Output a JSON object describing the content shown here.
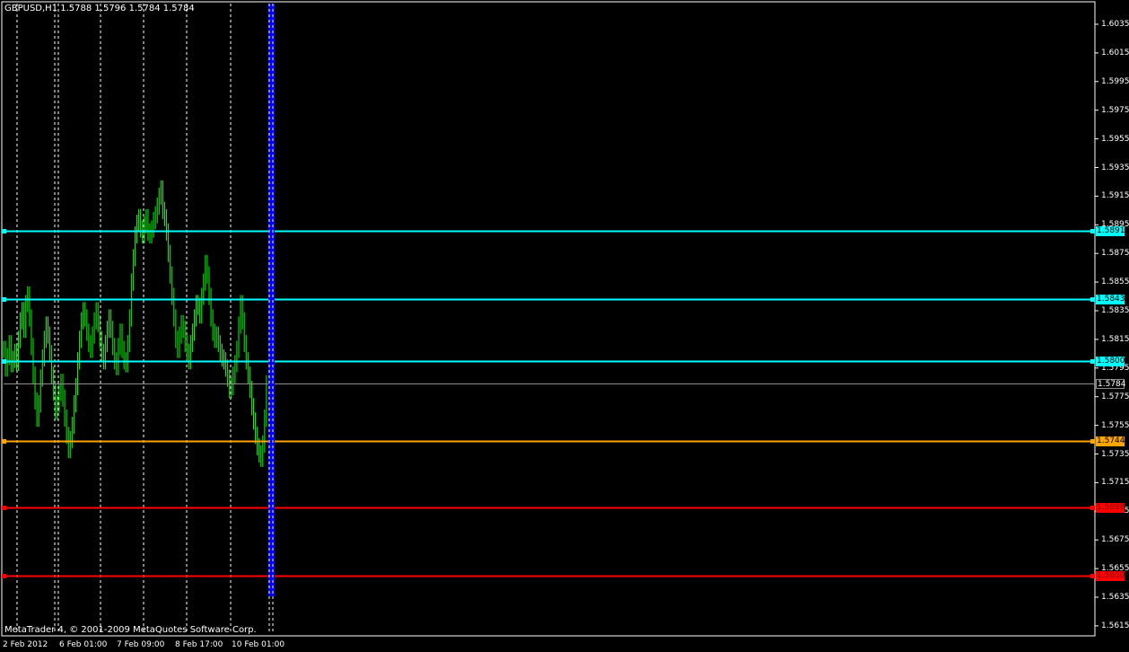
{
  "header": {
    "title": "GBPUSD,H1  1.5788 1.5796 1.5784 1.5784"
  },
  "footer": {
    "copyright": "MetaTrader 4, © 2001-2009 MetaQuotes Software Corp."
  },
  "colors": {
    "background": "#000000",
    "candles": "#00ff00",
    "cyan": "#00ffff",
    "orange": "#ffa500",
    "red": "#ff0000",
    "blue": "#0000ff",
    "grid": "#ffffff"
  },
  "price_axis": [
    "1.6035",
    "1.6015",
    "1.5995",
    "1.5975",
    "1.5955",
    "1.5935",
    "1.5915",
    "1.5895",
    "1.5875",
    "1.5855",
    "1.5835",
    "1.5815",
    "1.5795",
    "1.5775",
    "1.5755",
    "1.5735",
    "1.5715",
    "1.5695",
    "1.5675",
    "1.5655",
    "1.5635",
    "1.5615"
  ],
  "time_axis": [
    "2 Feb 2012",
    "6 Feb 01:00",
    "7 Feb 09:00",
    "8 Feb 17:00",
    "10 Feb 01:00"
  ],
  "levels": [
    {
      "price": "1.5891",
      "color": "cyan"
    },
    {
      "price": "1.5843",
      "color": "cyan"
    },
    {
      "price": "1.5800",
      "color": "cyan"
    },
    {
      "price": "1.5784",
      "color": "current"
    },
    {
      "price": "1.5744",
      "color": "orange"
    },
    {
      "price": "1.5698",
      "color": "red"
    },
    {
      "price": "1.5650",
      "color": "red"
    }
  ],
  "chart_data": {
    "type": "ohlc",
    "symbol": "GBPUSD",
    "timeframe": "H1",
    "ylim": [
      1.5605,
      1.6045
    ],
    "bar_closes": [
      1.5808,
      1.5795,
      1.5803,
      1.5812,
      1.5798,
      1.5801,
      1.5806,
      1.5799,
      1.5815,
      1.5828,
      1.5835,
      1.5822,
      1.584,
      1.5846,
      1.583,
      1.581,
      1.579,
      1.5772,
      1.576,
      1.577,
      1.5788,
      1.5802,
      1.5815,
      1.5825,
      1.5818,
      1.5805,
      1.579,
      1.5778,
      1.5765,
      1.577,
      1.5778,
      1.5785,
      1.5774,
      1.576,
      1.5748,
      1.5738,
      1.5745,
      1.5755,
      1.577,
      1.5782,
      1.58,
      1.5815,
      1.5828,
      1.5835,
      1.583,
      1.582,
      1.5812,
      1.5808,
      1.5818,
      1.5828,
      1.5835,
      1.5826,
      1.5815,
      1.5806,
      1.58,
      1.5812,
      1.5822,
      1.583,
      1.5822,
      1.581,
      1.58,
      1.5796,
      1.581,
      1.582,
      1.5808,
      1.58,
      1.5798,
      1.5812,
      1.583,
      1.5855,
      1.5872,
      1.5888,
      1.5896,
      1.59,
      1.5892,
      1.5888,
      1.5895,
      1.59,
      1.589,
      1.5888,
      1.5892,
      1.5898,
      1.5902,
      1.5908,
      1.5915,
      1.592,
      1.5905,
      1.59,
      1.589,
      1.5875,
      1.586,
      1.5845,
      1.583,
      1.5815,
      1.5808,
      1.5818,
      1.5826,
      1.5822,
      1.5812,
      1.5806,
      1.58,
      1.5812,
      1.582,
      1.583,
      1.584,
      1.5838,
      1.5832,
      1.5845,
      1.5855,
      1.5868,
      1.586,
      1.5845,
      1.583,
      1.582,
      1.5815,
      1.5818,
      1.5812,
      1.5806,
      1.5802,
      1.58,
      1.5795,
      1.5788,
      1.578,
      1.5782,
      1.579,
      1.5798,
      1.5808,
      1.5825,
      1.584,
      1.5828,
      1.5812,
      1.58,
      1.579,
      1.578,
      1.5768,
      1.5758,
      1.5748,
      1.574,
      1.5735,
      1.5732,
      1.5742,
      1.576,
      1.5784
    ]
  }
}
